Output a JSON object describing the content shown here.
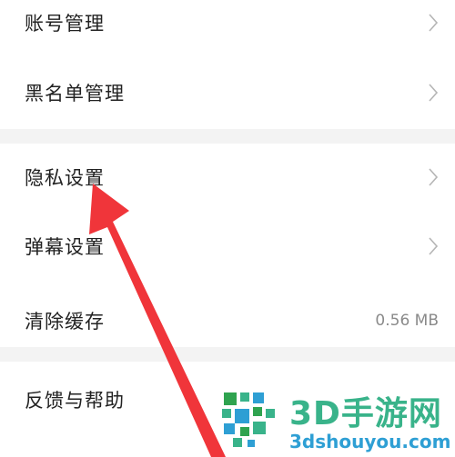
{
  "settings": {
    "items": [
      {
        "label": "账号管理",
        "icon": "chevron-right-icon"
      },
      {
        "label": "黑名单管理",
        "icon": "chevron-right-icon"
      },
      {
        "label": "隐私设置",
        "icon": "chevron-right-icon"
      },
      {
        "label": "弹幕设置",
        "icon": "chevron-right-icon"
      },
      {
        "label": "清除缓存",
        "value": "0.56 MB"
      },
      {
        "label": "反馈与帮助"
      }
    ]
  },
  "annotation": {
    "icon": "red-arrow-icon",
    "color": "#f0353a"
  },
  "watermark": {
    "text": "3D手游网",
    "subtext": "3dshouyou.com",
    "icon": "3d-logo-icon",
    "colors": {
      "main": "#39b38a",
      "sub": "#2e9fd4"
    }
  }
}
